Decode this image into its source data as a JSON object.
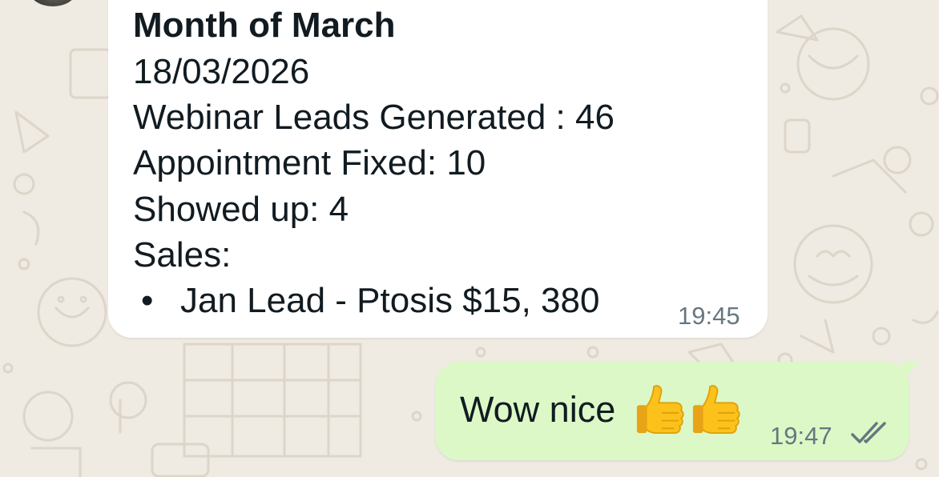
{
  "incoming_message": {
    "title": "Month of March",
    "date": "18/03/2026",
    "leads": "Webinar Leads Generated : 46",
    "appointments": "Appointment Fixed: 10",
    "showed_up": "Showed up: 4",
    "sales_label": "Sales:",
    "bullet": "•",
    "sales_items": [
      "Jan Lead - Ptosis $15, 380"
    ],
    "time": "19:45"
  },
  "outgoing_message": {
    "text": "Wow nice",
    "emojis": [
      "thumbs-up-icon",
      "thumbs-up-icon"
    ],
    "time": "19:47",
    "status": "read-double-check-icon"
  },
  "colors": {
    "wallpaper": "#efeae2",
    "incoming_bubble": "#ffffff",
    "outgoing_bubble": "#dcf8c6",
    "text": "#111b21",
    "meta": "#667781"
  }
}
